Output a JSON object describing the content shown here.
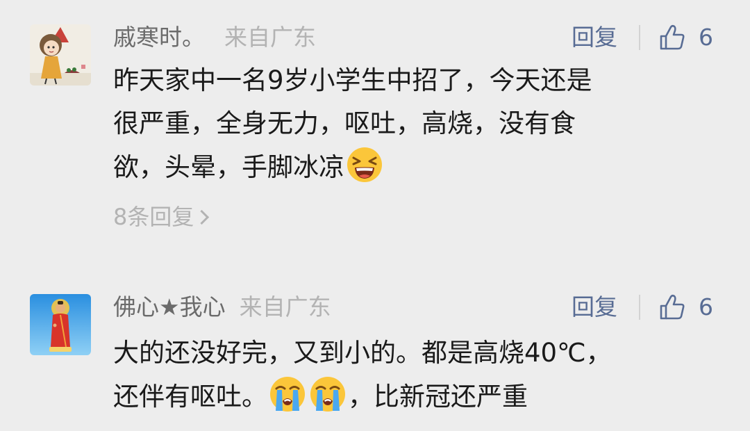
{
  "comments": [
    {
      "username": "戚寒时。",
      "location": "来自广东",
      "reply_label": "回复",
      "like_count": "6",
      "text_lines": [
        "昨天家中一名9岁小学生中招了，今天还是",
        "很严重，全身无力，呕吐，高烧，没有食",
        "欲，头晕，手脚冰凉"
      ],
      "line3_emoji": "tired-laughing-face-emoji",
      "replies_link": "8条回复"
    },
    {
      "username": "佛心★我心",
      "location": "来自广东",
      "reply_label": "回复",
      "like_count": "6",
      "text_lines": [
        "大的还没好完，又到小的。都是高烧40℃，",
        "还伴有呕吐。",
        "，比新冠还严重"
      ],
      "line2_emoji": "loudly-crying-face-emoji"
    }
  ],
  "icons": {
    "like": "thumbs-up-outline-icon"
  },
  "colors": {
    "background": "#ededed",
    "link_blue": "#586c94",
    "username_gray": "#6b6b6b",
    "muted_gray": "#b3b3b3",
    "text_black": "#1a1a1a"
  }
}
